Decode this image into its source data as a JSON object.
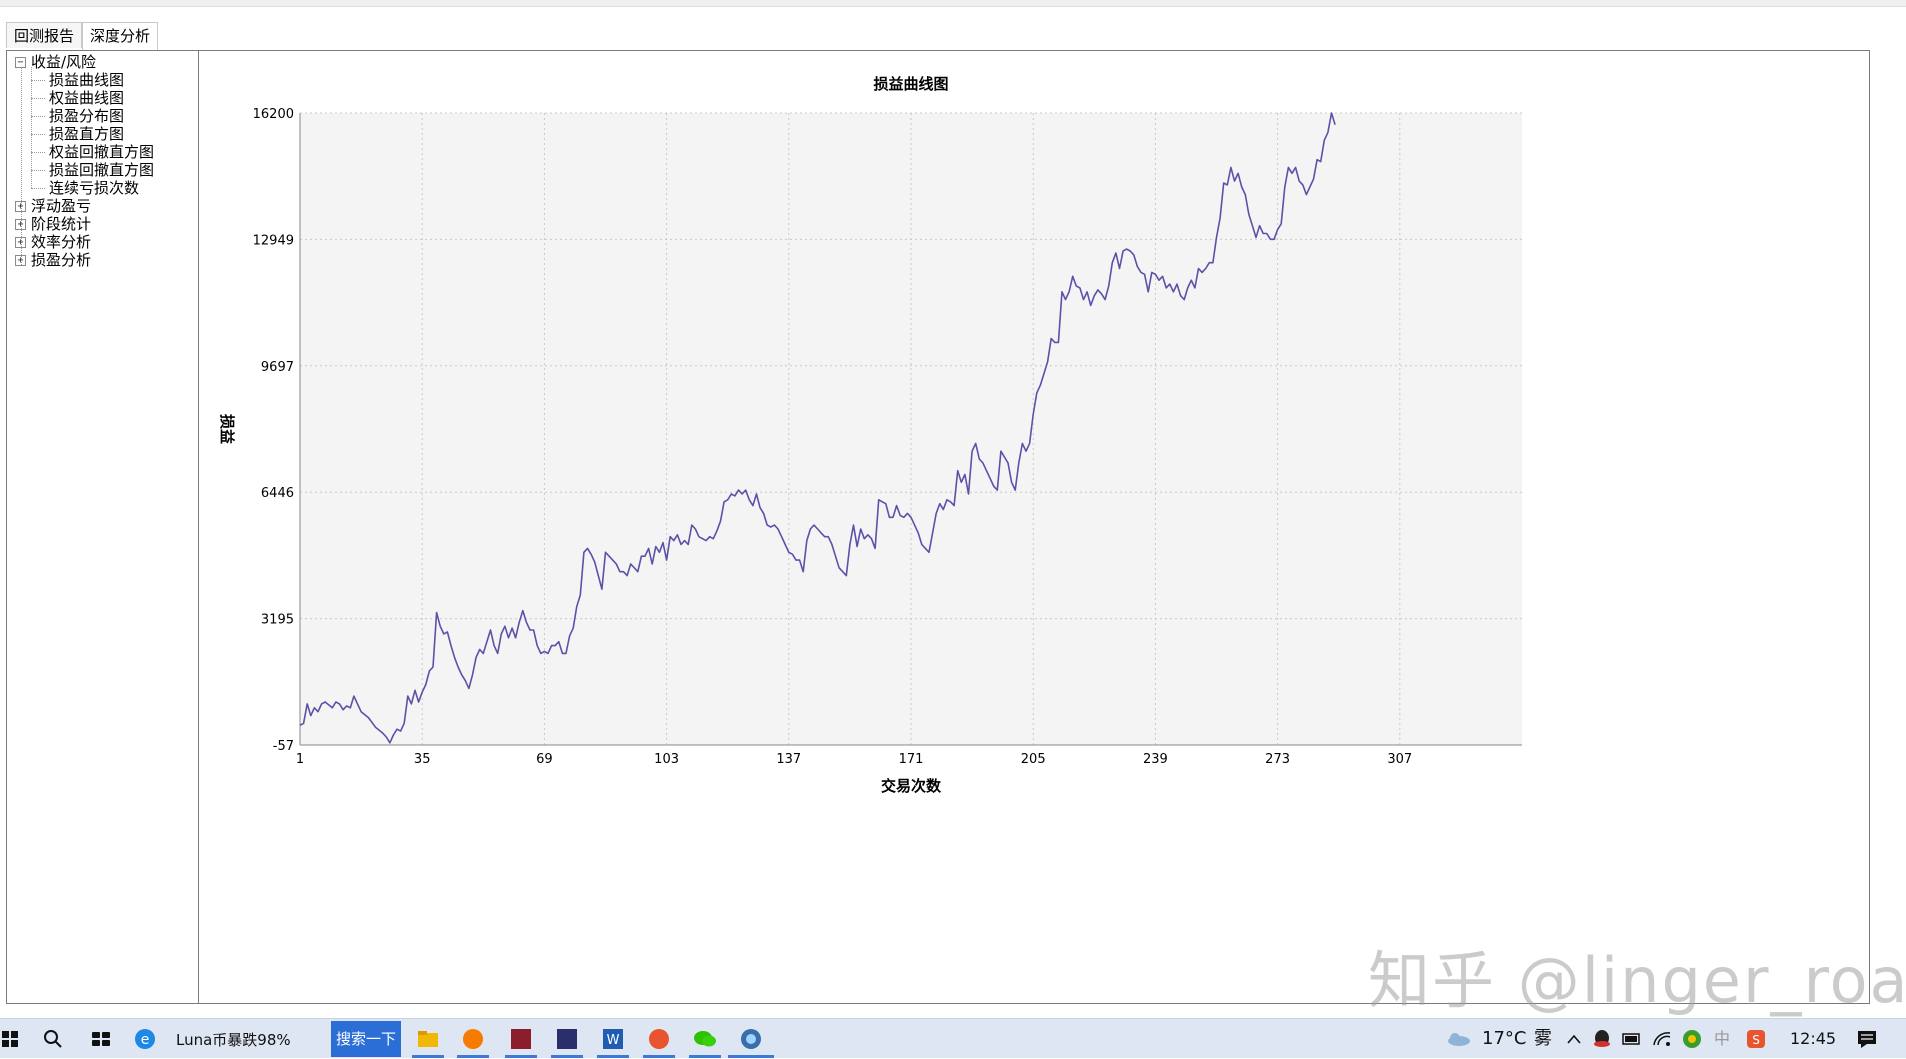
{
  "tabs": [
    {
      "label": "回测报告",
      "active": false
    },
    {
      "label": "深度分析",
      "active": true
    }
  ],
  "tree": [
    {
      "label": "收益/风险",
      "expanded": true,
      "level": 0,
      "expander": "−"
    },
    {
      "label": "损益曲线图",
      "level": 1
    },
    {
      "label": "权益曲线图",
      "level": 1
    },
    {
      "label": "损盈分布图",
      "level": 1
    },
    {
      "label": "损盈直方图",
      "level": 1
    },
    {
      "label": "权益回撤直方图",
      "level": 1
    },
    {
      "label": "损益回撤直方图",
      "level": 1
    },
    {
      "label": "连续亏损次数",
      "level": 1
    },
    {
      "label": "浮动盈亏",
      "expanded": false,
      "level": 0,
      "expander": "+"
    },
    {
      "label": "阶段统计",
      "expanded": false,
      "level": 0,
      "expander": "+"
    },
    {
      "label": "效率分析",
      "expanded": false,
      "level": 0,
      "expander": "+"
    },
    {
      "label": "损盈分析",
      "expanded": false,
      "level": 0,
      "expander": "+"
    }
  ],
  "chart_data": {
    "type": "line",
    "title": "损益曲线图",
    "xlabel": "交易次数",
    "ylabel": "损益",
    "xlim": [
      1,
      341
    ],
    "ylim": [
      -57,
      16200
    ],
    "x_ticks": [
      1,
      35,
      69,
      103,
      137,
      171,
      205,
      239,
      273,
      307
    ],
    "y_ticks": [
      -57,
      3195,
      6446,
      9697,
      12949,
      16200
    ],
    "grid": true,
    "colors": {
      "line": "#5a52a8",
      "plot_bg": "#f4f4f4",
      "grid": "#c8c8c8"
    },
    "series": [
      {
        "points": [
          [
            1,
            450
          ],
          [
            2,
            500
          ],
          [
            3,
            1000
          ],
          [
            4,
            700
          ],
          [
            5,
            900
          ],
          [
            6,
            800
          ],
          [
            7,
            1000
          ],
          [
            8,
            1050
          ],
          [
            10,
            900
          ],
          [
            11,
            1050
          ],
          [
            12,
            1000
          ],
          [
            13,
            850
          ],
          [
            14,
            950
          ],
          [
            15,
            900
          ],
          [
            16,
            1200
          ],
          [
            17,
            1000
          ],
          [
            18,
            800
          ],
          [
            20,
            650
          ],
          [
            22,
            400
          ],
          [
            24,
            250
          ],
          [
            25,
            150
          ],
          [
            26,
            0
          ],
          [
            27,
            200
          ],
          [
            28,
            350
          ],
          [
            29,
            300
          ],
          [
            30,
            500
          ],
          [
            31,
            1200
          ],
          [
            32,
            1000
          ],
          [
            33,
            1350
          ],
          [
            34,
            1050
          ],
          [
            35,
            1300
          ],
          [
            36,
            1500
          ],
          [
            37,
            1850
          ],
          [
            38,
            1950
          ],
          [
            39,
            3350
          ],
          [
            40,
            3000
          ],
          [
            41,
            2800
          ],
          [
            42,
            2850
          ],
          [
            43,
            2500
          ],
          [
            44,
            2200
          ],
          [
            45,
            1950
          ],
          [
            46,
            1750
          ],
          [
            47,
            1600
          ],
          [
            48,
            1400
          ],
          [
            49,
            1750
          ],
          [
            50,
            2200
          ],
          [
            51,
            2400
          ],
          [
            52,
            2300
          ],
          [
            53,
            2600
          ],
          [
            54,
            2900
          ],
          [
            55,
            2500
          ],
          [
            56,
            2300
          ],
          [
            57,
            2800
          ],
          [
            58,
            3000
          ],
          [
            59,
            2700
          ],
          [
            60,
            2950
          ],
          [
            61,
            2700
          ],
          [
            62,
            3100
          ],
          [
            63,
            3400
          ],
          [
            64,
            3100
          ],
          [
            65,
            2900
          ],
          [
            66,
            2900
          ],
          [
            67,
            2500
          ],
          [
            68,
            2300
          ],
          [
            69,
            2350
          ],
          [
            70,
            2300
          ],
          [
            71,
            2500
          ],
          [
            72,
            2500
          ],
          [
            73,
            2600
          ],
          [
            74,
            2300
          ],
          [
            75,
            2300
          ],
          [
            76,
            2750
          ],
          [
            77,
            2950
          ],
          [
            78,
            3500
          ],
          [
            79,
            3800
          ],
          [
            80,
            4900
          ],
          [
            81,
            5000
          ],
          [
            82,
            4850
          ],
          [
            83,
            4650
          ],
          [
            84,
            4300
          ],
          [
            85,
            3950
          ],
          [
            86,
            4900
          ],
          [
            87,
            4800
          ],
          [
            88,
            4700
          ],
          [
            89,
            4600
          ],
          [
            90,
            4400
          ],
          [
            91,
            4400
          ],
          [
            92,
            4300
          ],
          [
            93,
            4600
          ],
          [
            94,
            4500
          ],
          [
            95,
            4400
          ],
          [
            96,
            4800
          ],
          [
            97,
            4800
          ],
          [
            98,
            5000
          ],
          [
            99,
            4600
          ],
          [
            100,
            5050
          ],
          [
            101,
            4900
          ],
          [
            102,
            5150
          ],
          [
            103,
            4700
          ],
          [
            104,
            5300
          ],
          [
            105,
            5200
          ],
          [
            106,
            5350
          ],
          [
            107,
            5100
          ],
          [
            108,
            5200
          ],
          [
            109,
            5100
          ],
          [
            110,
            5600
          ],
          [
            111,
            5500
          ],
          [
            112,
            5300
          ],
          [
            113,
            5250
          ],
          [
            114,
            5200
          ],
          [
            115,
            5300
          ],
          [
            116,
            5250
          ],
          [
            117,
            5450
          ],
          [
            118,
            5700
          ],
          [
            119,
            6200
          ],
          [
            120,
            6250
          ],
          [
            121,
            6400
          ],
          [
            122,
            6350
          ],
          [
            123,
            6500
          ],
          [
            124,
            6400
          ],
          [
            125,
            6500
          ],
          [
            126,
            6250
          ],
          [
            127,
            6100
          ],
          [
            128,
            6400
          ],
          [
            129,
            6050
          ],
          [
            130,
            5900
          ],
          [
            131,
            5600
          ],
          [
            132,
            5550
          ],
          [
            133,
            5600
          ],
          [
            134,
            5500
          ],
          [
            135,
            5300
          ],
          [
            136,
            5100
          ],
          [
            137,
            4900
          ],
          [
            138,
            4850
          ],
          [
            139,
            4700
          ],
          [
            140,
            4700
          ],
          [
            141,
            4400
          ],
          [
            142,
            5200
          ],
          [
            143,
            5500
          ],
          [
            144,
            5600
          ],
          [
            145,
            5500
          ],
          [
            146,
            5400
          ],
          [
            147,
            5300
          ],
          [
            148,
            5300
          ],
          [
            149,
            5100
          ],
          [
            150,
            4800
          ],
          [
            151,
            4500
          ],
          [
            152,
            4400
          ],
          [
            153,
            4300
          ],
          [
            154,
            5100
          ],
          [
            155,
            5600
          ],
          [
            156,
            5050
          ],
          [
            157,
            5500
          ],
          [
            158,
            5250
          ],
          [
            159,
            5350
          ],
          [
            160,
            5250
          ],
          [
            161,
            5000
          ],
          [
            162,
            6250
          ],
          [
            163,
            6200
          ],
          [
            164,
            6150
          ],
          [
            165,
            5800
          ],
          [
            166,
            5800
          ],
          [
            167,
            6100
          ],
          [
            168,
            5850
          ],
          [
            169,
            5800
          ],
          [
            170,
            5900
          ],
          [
            171,
            5800
          ],
          [
            172,
            5600
          ],
          [
            173,
            5400
          ],
          [
            174,
            5100
          ],
          [
            175,
            5000
          ],
          [
            176,
            4900
          ],
          [
            177,
            5400
          ],
          [
            178,
            5900
          ],
          [
            179,
            6150
          ],
          [
            180,
            6000
          ],
          [
            181,
            6250
          ],
          [
            182,
            6200
          ],
          [
            183,
            6100
          ],
          [
            184,
            7000
          ],
          [
            185,
            6700
          ],
          [
            186,
            6900
          ],
          [
            187,
            6400
          ],
          [
            188,
            7500
          ],
          [
            189,
            7700
          ],
          [
            190,
            7300
          ],
          [
            191,
            7200
          ],
          [
            192,
            7000
          ],
          [
            193,
            6800
          ],
          [
            194,
            6600
          ],
          [
            195,
            6500
          ],
          [
            196,
            7500
          ],
          [
            197,
            7350
          ],
          [
            198,
            7200
          ],
          [
            199,
            6700
          ],
          [
            200,
            6500
          ],
          [
            201,
            7200
          ],
          [
            202,
            7700
          ],
          [
            203,
            7500
          ],
          [
            204,
            7700
          ],
          [
            205,
            8450
          ],
          [
            206,
            9000
          ],
          [
            207,
            9200
          ],
          [
            208,
            9500
          ],
          [
            209,
            9800
          ],
          [
            210,
            10400
          ],
          [
            211,
            10300
          ],
          [
            212,
            10300
          ],
          [
            213,
            11600
          ],
          [
            214,
            11400
          ],
          [
            215,
            11600
          ],
          [
            216,
            12000
          ],
          [
            217,
            11750
          ],
          [
            218,
            11700
          ],
          [
            219,
            11400
          ],
          [
            220,
            11600
          ],
          [
            221,
            11250
          ],
          [
            222,
            11500
          ],
          [
            223,
            11650
          ],
          [
            224,
            11550
          ],
          [
            225,
            11400
          ],
          [
            226,
            11750
          ],
          [
            227,
            12350
          ],
          [
            228,
            12600
          ],
          [
            229,
            12200
          ],
          [
            230,
            12650
          ],
          [
            231,
            12700
          ],
          [
            232,
            12650
          ],
          [
            233,
            12550
          ],
          [
            234,
            12250
          ],
          [
            235,
            12100
          ],
          [
            236,
            12050
          ],
          [
            237,
            11600
          ],
          [
            238,
            12100
          ],
          [
            239,
            12050
          ],
          [
            240,
            11900
          ],
          [
            241,
            12000
          ],
          [
            242,
            11700
          ],
          [
            243,
            11800
          ],
          [
            244,
            11600
          ],
          [
            245,
            11800
          ],
          [
            246,
            11500
          ],
          [
            247,
            11400
          ],
          [
            248,
            11700
          ],
          [
            249,
            11900
          ],
          [
            250,
            11700
          ],
          [
            251,
            12200
          ],
          [
            252,
            12100
          ],
          [
            253,
            12200
          ],
          [
            254,
            12350
          ],
          [
            255,
            12350
          ],
          [
            256,
            13000
          ],
          [
            257,
            13500
          ],
          [
            258,
            14400
          ],
          [
            259,
            14350
          ],
          [
            260,
            14800
          ],
          [
            261,
            14450
          ],
          [
            262,
            14650
          ],
          [
            263,
            14300
          ],
          [
            264,
            14100
          ],
          [
            265,
            13600
          ],
          [
            266,
            13300
          ],
          [
            267,
            13000
          ],
          [
            268,
            13300
          ],
          [
            269,
            13100
          ],
          [
            270,
            13100
          ],
          [
            271,
            12950
          ],
          [
            272,
            12950
          ],
          [
            273,
            13200
          ],
          [
            274,
            13350
          ],
          [
            275,
            14300
          ],
          [
            276,
            14800
          ],
          [
            277,
            14650
          ],
          [
            278,
            14800
          ],
          [
            279,
            14450
          ],
          [
            280,
            14350
          ],
          [
            281,
            14100
          ],
          [
            282,
            14300
          ],
          [
            283,
            14500
          ],
          [
            284,
            15000
          ],
          [
            285,
            14950
          ],
          [
            286,
            15500
          ],
          [
            287,
            15700
          ],
          [
            288,
            16200
          ],
          [
            289,
            15900
          ]
        ]
      }
    ]
  },
  "watermark": "知乎 @linger_road",
  "taskbar": {
    "task_title": "Luna币暴跌98%",
    "search_button": "搜索一下",
    "weather": "17°C",
    "weather_desc": "雾",
    "time": "12:45",
    "ime": "中"
  }
}
